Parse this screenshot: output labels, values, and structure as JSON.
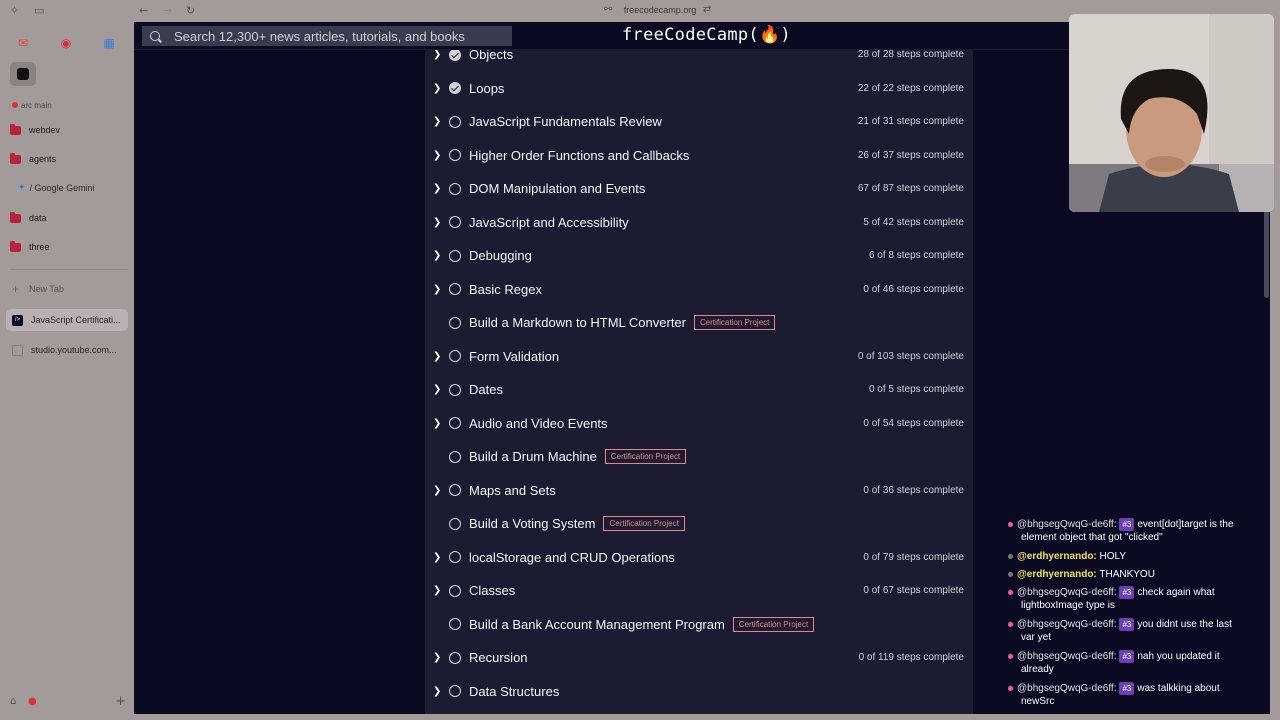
{
  "browser": {
    "url": "freecodecamp.org"
  },
  "sidebar": {
    "space_label": "arc main",
    "folders": [
      "webdev",
      "agents",
      "data",
      "three"
    ],
    "gemini_label": "/ Google Gemini",
    "new_tab_label": "New Tab",
    "tabs": [
      {
        "label": "JavaScript Certificati...",
        "active": true
      },
      {
        "label": "studio.youtube.com...",
        "active": false
      }
    ]
  },
  "fcc": {
    "search_placeholder": "Search 12,300+ news articles, tutorials, and books",
    "logo": "freeCodeCamp(🔥)"
  },
  "curriculum": [
    {
      "title": "Objects",
      "steps": "28 of 28 steps complete",
      "done": true,
      "expandable": true
    },
    {
      "title": "Loops",
      "steps": "22 of 22 steps complete",
      "done": true,
      "expandable": true
    },
    {
      "title": "JavaScript Fundamentals Review",
      "steps": "21 of 31 steps complete",
      "done": false,
      "expandable": true
    },
    {
      "title": "Higher Order Functions and Callbacks",
      "steps": "26 of 37 steps complete",
      "done": false,
      "expandable": true
    },
    {
      "title": "DOM Manipulation and Events",
      "steps": "67 of 87 steps complete",
      "done": false,
      "expandable": true
    },
    {
      "title": "JavaScript and Accessibility",
      "steps": "5 of 42 steps complete",
      "done": false,
      "expandable": true
    },
    {
      "title": "Debugging",
      "steps": "6 of 8 steps complete",
      "done": false,
      "expandable": true
    },
    {
      "title": "Basic Regex",
      "steps": "0 of 46 steps complete",
      "done": false,
      "expandable": true
    },
    {
      "title": "Build a Markdown to HTML Converter",
      "badge": "Certification Project",
      "done": false,
      "expandable": false
    },
    {
      "title": "Form Validation",
      "steps": "0 of 103 steps complete",
      "done": false,
      "expandable": true
    },
    {
      "title": "Dates",
      "steps": "0 of 5 steps complete",
      "done": false,
      "expandable": true
    },
    {
      "title": "Audio and Video Events",
      "steps": "0 of 54 steps complete",
      "done": false,
      "expandable": true
    },
    {
      "title": "Build a Drum Machine",
      "badge": "Certification Project",
      "done": false,
      "expandable": false
    },
    {
      "title": "Maps and Sets",
      "steps": "0 of 36 steps complete",
      "done": false,
      "expandable": true
    },
    {
      "title": "Build a Voting System",
      "badge": "Certification Project",
      "done": false,
      "expandable": false
    },
    {
      "title": "localStorage and CRUD Operations",
      "steps": "0 of 79 steps complete",
      "done": false,
      "expandable": true
    },
    {
      "title": "Classes",
      "steps": "0 of 67 steps complete",
      "done": false,
      "expandable": true
    },
    {
      "title": "Build a Bank Account Management Program",
      "badge": "Certification Project",
      "done": false,
      "expandable": false
    },
    {
      "title": "Recursion",
      "steps": "0 of 119 steps complete",
      "done": false,
      "expandable": true
    },
    {
      "title": "Data Structures",
      "steps": "",
      "done": false,
      "expandable": true
    }
  ],
  "chat": [
    {
      "user": "@bhgsegQwqG-de6ff:",
      "rank": "#3",
      "line1": "event[dot]target is the",
      "line2": "element object that got \"clicked\""
    },
    {
      "user": "@erdhyernando:",
      "yellow": true,
      "line1": "HOLY",
      "line2": ""
    },
    {
      "user": "@erdhyernando:",
      "yellow": true,
      "line1": "THANKYOU",
      "line2": ""
    },
    {
      "user": "@bhgsegQwqG-de6ff:",
      "rank": "#3",
      "line1": "check again what",
      "line2": "lightboxImage type is"
    },
    {
      "user": "@bhgsegQwqG-de6ff:",
      "rank": "#3",
      "line1": "you didnt use the last",
      "line2": "var yet"
    },
    {
      "user": "@bhgsegQwqG-de6ff:",
      "rank": "#3",
      "line1": "nah you updated it",
      "line2": "already"
    },
    {
      "user": "@bhgsegQwqG-de6ff:",
      "rank": "#3",
      "line1": "was talkking about",
      "line2": "newSrc"
    }
  ]
}
